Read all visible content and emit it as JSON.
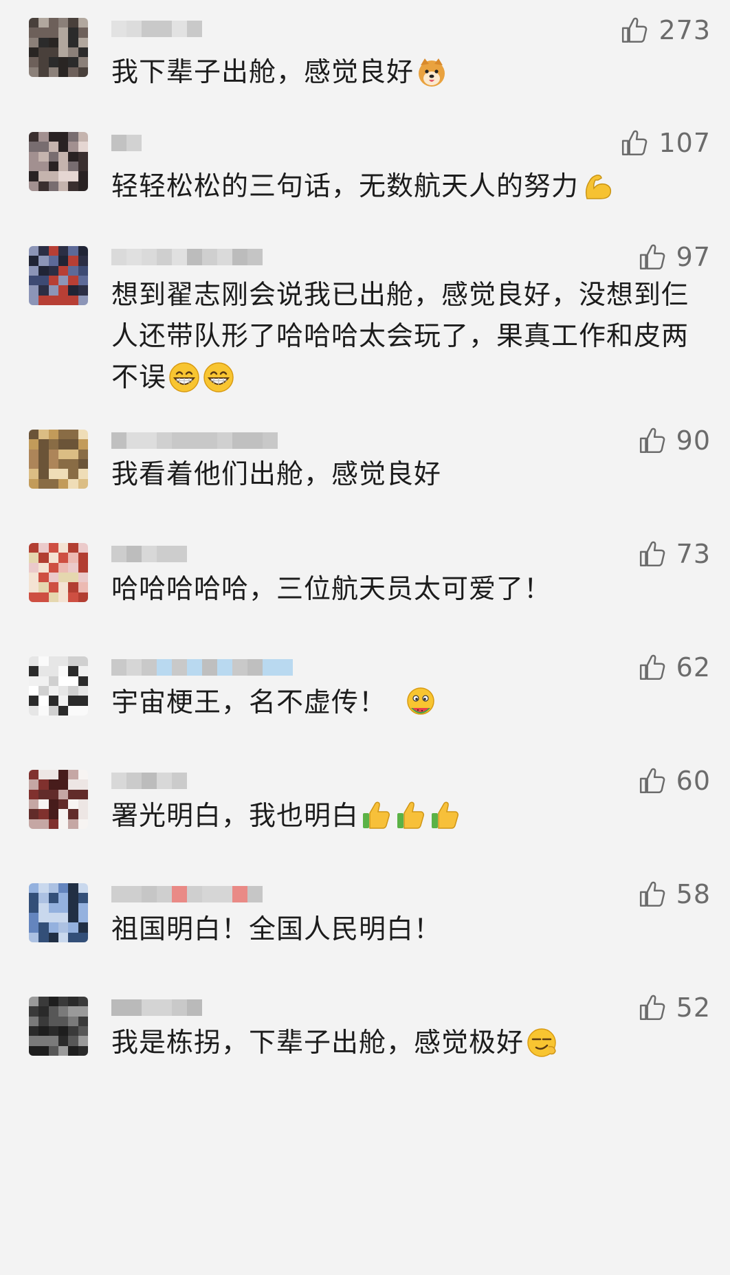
{
  "icons": {
    "like": "thumbs-up-icon"
  },
  "comments": [
    {
      "text": "我下辈子出舱，感觉良好",
      "likes": "273",
      "emojis": [
        "doge-emoji"
      ]
    },
    {
      "text": "轻轻松松的三句话，无数航天人的努力",
      "likes": "107",
      "emojis": [
        "flexed-biceps-emoji"
      ]
    },
    {
      "text": "想到翟志刚会说我已出舱，感觉良好，没想到仨人还带队形了哈哈哈太会玩了，果真工作和皮两不误",
      "likes": "97",
      "emojis": [
        "grinning-face-emoji",
        "grinning-face-emoji"
      ]
    },
    {
      "text": "我看着他们出舱，感觉良好",
      "likes": "90",
      "emojis": []
    },
    {
      "text": "哈哈哈哈哈，三位航天员太可爱了！",
      "likes": "73",
      "emojis": []
    },
    {
      "text": "宇宙梗王，名不虚传！",
      "likes": "62",
      "emojis": [
        "melon-eating-face-emoji"
      ]
    },
    {
      "text": "署光明白，我也明白",
      "likes": "60",
      "emojis": [
        "thumbs-up-emoji",
        "thumbs-up-emoji",
        "thumbs-up-emoji"
      ]
    },
    {
      "text": "祖国明白！全国人民明白！",
      "likes": "58",
      "emojis": []
    },
    {
      "text": "我是栋拐，下辈子出舱，感觉极好",
      "likes": "52",
      "emojis": [
        "smirking-face-emoji"
      ]
    }
  ]
}
